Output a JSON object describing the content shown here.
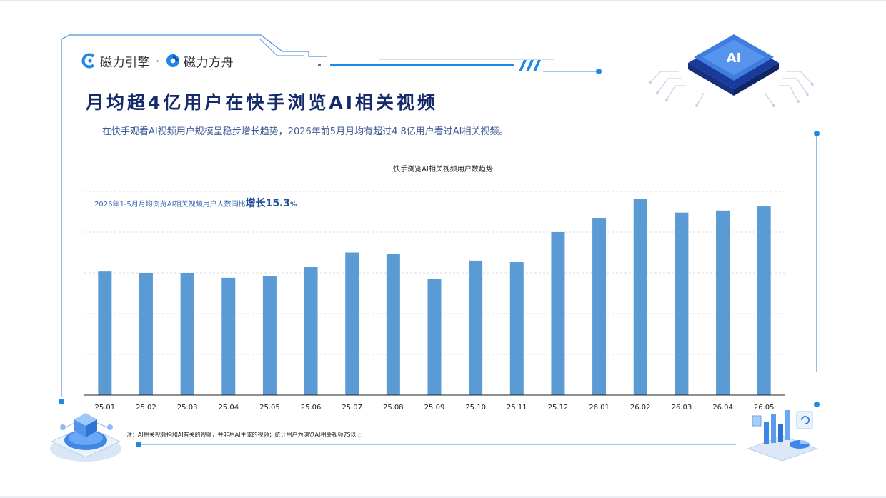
{
  "brand": {
    "logo1_text": "磁力引擎",
    "separator": "·",
    "logo2_text": "磁力方舟"
  },
  "header": {
    "title": "月均超4亿用户在快手浏览AI相关视频",
    "subtitle": "在快手观看AI视频用户规模呈稳步增长趋势，2026年前5月月均有超过4.8亿用户看过AI相关视频。"
  },
  "decor": {
    "chip_label": "AI",
    "chip_icon": "ai-chip-icon",
    "left_icon": "iso-cube-platform-icon",
    "right_icon": "iso-analytics-dashboard-icon"
  },
  "annotation": {
    "text": "2026年1-5月月均浏览AI相关视频用户人数同比",
    "highlight": "增长15.3",
    "unit": "%"
  },
  "footer": {
    "note": "注：AI相关视频指和AI有关的视频，并非用AI生成的视频；统计用户为浏览AI相关视频7S以上"
  },
  "colors": {
    "bar": "#5b9bd5",
    "title": "#152a6b",
    "frame": "#4a90e2",
    "accent": "#1e88e5"
  },
  "chart_data": {
    "type": "bar",
    "title": "快手浏览AI相关视频用户数趋势",
    "categories": [
      "25.01",
      "25.02",
      "25.03",
      "25.04",
      "25.05",
      "25.06",
      "25.07",
      "25.08",
      "25.09",
      "25.10",
      "25.11",
      "25.12",
      "26.01",
      "26.02",
      "26.03",
      "26.04",
      "26.05"
    ],
    "values": [
      30.5,
      30.0,
      30.0,
      28.8,
      29.3,
      31.5,
      35.0,
      34.7,
      28.5,
      33.0,
      32.8,
      40.0,
      43.5,
      48.2,
      44.8,
      45.3,
      46.3
    ],
    "ylim": [
      0,
      50
    ],
    "yticks_shown": false,
    "grid": true,
    "legend": "none",
    "xlabel": "",
    "ylabel": ""
  }
}
